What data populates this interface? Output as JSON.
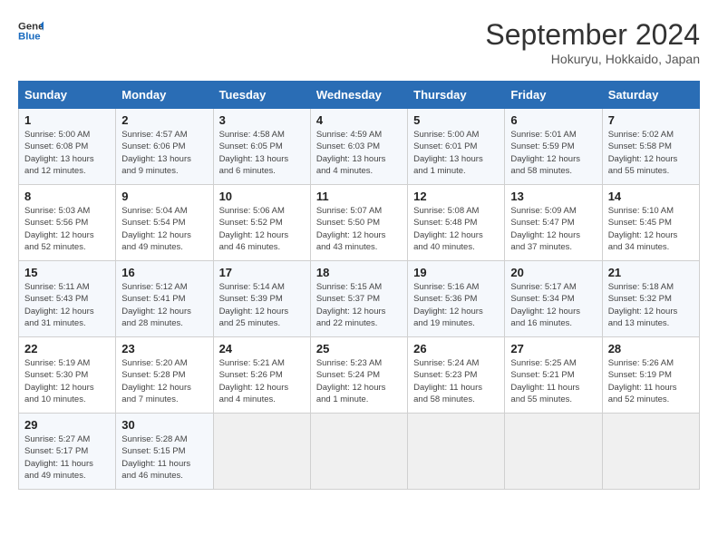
{
  "header": {
    "logo_line1": "General",
    "logo_line2": "Blue",
    "month": "September 2024",
    "location": "Hokuryu, Hokkaido, Japan"
  },
  "weekdays": [
    "Sunday",
    "Monday",
    "Tuesday",
    "Wednesday",
    "Thursday",
    "Friday",
    "Saturday"
  ],
  "weeks": [
    [
      {
        "day": "1",
        "rise": "5:00 AM",
        "set": "6:08 PM",
        "daylight": "13 hours and 12 minutes."
      },
      {
        "day": "2",
        "rise": "4:57 AM",
        "set": "6:06 PM",
        "daylight": "13 hours and 9 minutes."
      },
      {
        "day": "3",
        "rise": "4:58 AM",
        "set": "6:05 PM",
        "daylight": "13 hours and 6 minutes."
      },
      {
        "day": "4",
        "rise": "4:59 AM",
        "set": "6:03 PM",
        "daylight": "13 hours and 4 minutes."
      },
      {
        "day": "5",
        "rise": "5:00 AM",
        "set": "6:01 PM",
        "daylight": "13 hours and 1 minute."
      },
      {
        "day": "6",
        "rise": "5:01 AM",
        "set": "5:59 PM",
        "daylight": "12 hours and 58 minutes."
      },
      {
        "day": "7",
        "rise": "5:02 AM",
        "set": "5:58 PM",
        "daylight": "12 hours and 55 minutes."
      }
    ],
    [
      {
        "day": "8",
        "rise": "5:03 AM",
        "set": "5:56 PM",
        "daylight": "12 hours and 52 minutes."
      },
      {
        "day": "9",
        "rise": "5:04 AM",
        "set": "5:54 PM",
        "daylight": "12 hours and 49 minutes."
      },
      {
        "day": "10",
        "rise": "5:06 AM",
        "set": "5:52 PM",
        "daylight": "12 hours and 46 minutes."
      },
      {
        "day": "11",
        "rise": "5:07 AM",
        "set": "5:50 PM",
        "daylight": "12 hours and 43 minutes."
      },
      {
        "day": "12",
        "rise": "5:08 AM",
        "set": "5:48 PM",
        "daylight": "12 hours and 40 minutes."
      },
      {
        "day": "13",
        "rise": "5:09 AM",
        "set": "5:47 PM",
        "daylight": "12 hours and 37 minutes."
      },
      {
        "day": "14",
        "rise": "5:10 AM",
        "set": "5:45 PM",
        "daylight": "12 hours and 34 minutes."
      }
    ],
    [
      {
        "day": "15",
        "rise": "5:11 AM",
        "set": "5:43 PM",
        "daylight": "12 hours and 31 minutes."
      },
      {
        "day": "16",
        "rise": "5:12 AM",
        "set": "5:41 PM",
        "daylight": "12 hours and 28 minutes."
      },
      {
        "day": "17",
        "rise": "5:14 AM",
        "set": "5:39 PM",
        "daylight": "12 hours and 25 minutes."
      },
      {
        "day": "18",
        "rise": "5:15 AM",
        "set": "5:37 PM",
        "daylight": "12 hours and 22 minutes."
      },
      {
        "day": "19",
        "rise": "5:16 AM",
        "set": "5:36 PM",
        "daylight": "12 hours and 19 minutes."
      },
      {
        "day": "20",
        "rise": "5:17 AM",
        "set": "5:34 PM",
        "daylight": "12 hours and 16 minutes."
      },
      {
        "day": "21",
        "rise": "5:18 AM",
        "set": "5:32 PM",
        "daylight": "12 hours and 13 minutes."
      }
    ],
    [
      {
        "day": "22",
        "rise": "5:19 AM",
        "set": "5:30 PM",
        "daylight": "12 hours and 10 minutes."
      },
      {
        "day": "23",
        "rise": "5:20 AM",
        "set": "5:28 PM",
        "daylight": "12 hours and 7 minutes."
      },
      {
        "day": "24",
        "rise": "5:21 AM",
        "set": "5:26 PM",
        "daylight": "12 hours and 4 minutes."
      },
      {
        "day": "25",
        "rise": "5:23 AM",
        "set": "5:24 PM",
        "daylight": "12 hours and 1 minute."
      },
      {
        "day": "26",
        "rise": "5:24 AM",
        "set": "5:23 PM",
        "daylight": "11 hours and 58 minutes."
      },
      {
        "day": "27",
        "rise": "5:25 AM",
        "set": "5:21 PM",
        "daylight": "11 hours and 55 minutes."
      },
      {
        "day": "28",
        "rise": "5:26 AM",
        "set": "5:19 PM",
        "daylight": "11 hours and 52 minutes."
      }
    ],
    [
      {
        "day": "29",
        "rise": "5:27 AM",
        "set": "5:17 PM",
        "daylight": "11 hours and 49 minutes."
      },
      {
        "day": "30",
        "rise": "5:28 AM",
        "set": "5:15 PM",
        "daylight": "11 hours and 46 minutes."
      },
      null,
      null,
      null,
      null,
      null
    ]
  ],
  "labels": {
    "sunrise": "Sunrise:",
    "sunset": "Sunset:",
    "daylight": "Daylight:"
  }
}
